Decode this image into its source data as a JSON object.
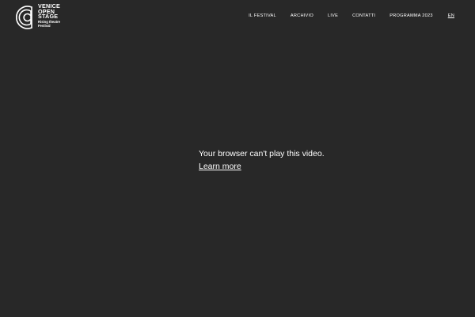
{
  "header": {
    "logo": {
      "icon": "venice-open-stage-logo-icon",
      "name_lines": [
        "VENICE",
        "OPEN",
        "STAGE"
      ],
      "tagline_lines": [
        "Rising theatre",
        "Festival"
      ]
    },
    "nav": {
      "items": [
        {
          "label": "IL FESTIVAL"
        },
        {
          "label": "ARCHIVIO"
        },
        {
          "label": "LIVE"
        },
        {
          "label": "CONTATTI"
        },
        {
          "label": "PROGRAMMA 2023"
        }
      ],
      "language": "EN"
    }
  },
  "video": {
    "message": "Your browser can't play this video.",
    "link_label": "Learn more"
  },
  "colors": {
    "background": "#282828",
    "text": "#ffffff"
  }
}
